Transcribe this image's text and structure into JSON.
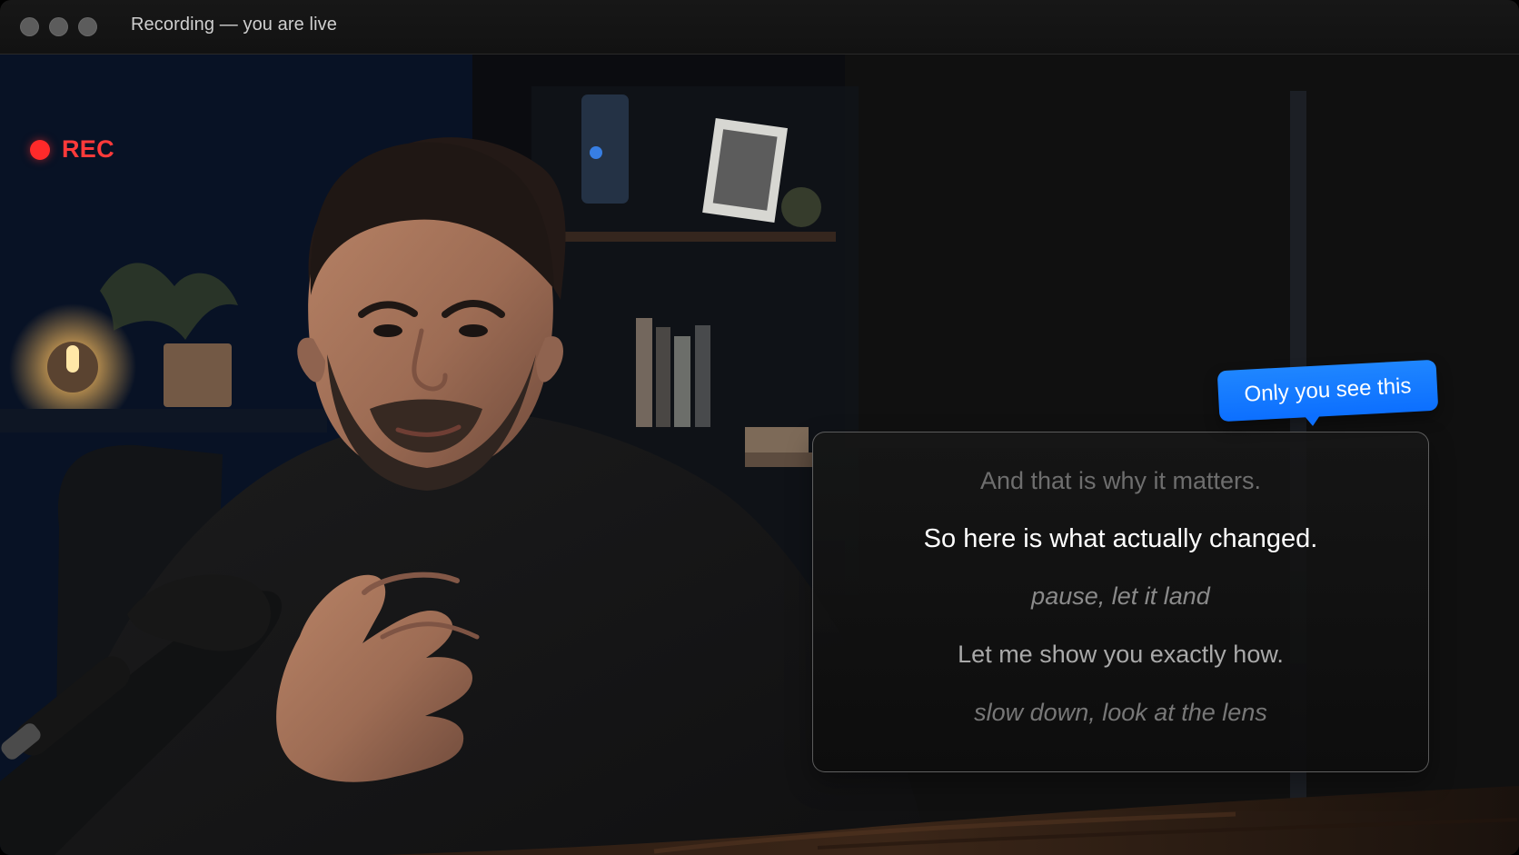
{
  "window": {
    "title": "Recording — you are live"
  },
  "recording": {
    "label": "REC"
  },
  "teleprompter": {
    "badge": "Only you see this",
    "lines": {
      "previous": "And that is why it matters.",
      "current": "So here is what actually changed.",
      "cue_1": "pause, let it land",
      "next": "Let me show you exactly how.",
      "cue_2": "slow down, look at the lens"
    }
  },
  "colors": {
    "record": "#ff2a2a",
    "badge": "#0c6fff",
    "titlebar": "#151515"
  },
  "icons": {
    "record_indicator": "record-dot-icon",
    "window_controls": "traffic-light-icons"
  }
}
